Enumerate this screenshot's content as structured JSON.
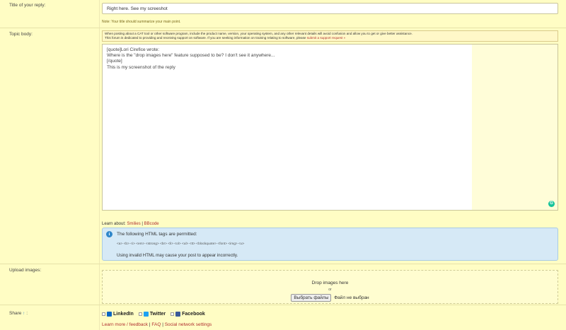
{
  "title_row": {
    "label": "Title of your reply:",
    "value": "Right here. See my screeshot",
    "note": "Note: Your title should summarize your main point."
  },
  "body_row": {
    "label": "Topic body:",
    "notice_line1": "When posting about a CAT tool or other software program, include the product name, version, your operating system, and any other relevant details will avoid confusion and allow you to get or give better assistance.",
    "notice_line2": "This forum is dedicated to providing and receiving support on software. If you are seeking information on training relating to software, please",
    "notice_link": "submit a support request »",
    "editor_lines": [
      "[quote]Lori Cirefice wrote:",
      "",
      "Where is the \"drop images here\" feature supposed to be? I don't see it anywhere...",
      "[/quote]",
      "",
      "This is my screenshot of the reply"
    ],
    "learn_prefix": "Learn about:",
    "learn_smilies": "Smilies",
    "learn_sep": "|",
    "learn_bbcode": "BBcode",
    "info_head": "The following HTML tags are permitted:",
    "info_tags": "<a> <b> <i> <em> <strong> <br> <li> <ol> <ul> <tt> <blockquote> <font> <img> <u>",
    "info_warn": "Using invalid HTML may cause your post to appear incorrectly."
  },
  "upload_row": {
    "label": "Upload images:",
    "drop_text": "Drop images here",
    "or_text": "or",
    "file_button": "Выбрать файлы",
    "file_status": "Файл не выбран"
  },
  "share_row": {
    "label": "Share",
    "label_suffix": ":",
    "linkedin": "LinkedIn",
    "twitter": "Twitter",
    "facebook": "Facebook",
    "learn_more": "Learn more / feedback",
    "sep": "|",
    "faq": "FAQ",
    "settings": "Social network settings"
  },
  "icons": {
    "info": "info-icon",
    "grammar": "grammarly-icon",
    "share": "share-arrow-icon",
    "linkedin": "linkedin-icon",
    "twitter": "twitter-icon",
    "facebook": "facebook-icon"
  },
  "colors": {
    "page_bg": "#fffdd0",
    "link": "#b03030",
    "info_bg": "#d6e9f6",
    "grammar_green": "#15c39a"
  }
}
